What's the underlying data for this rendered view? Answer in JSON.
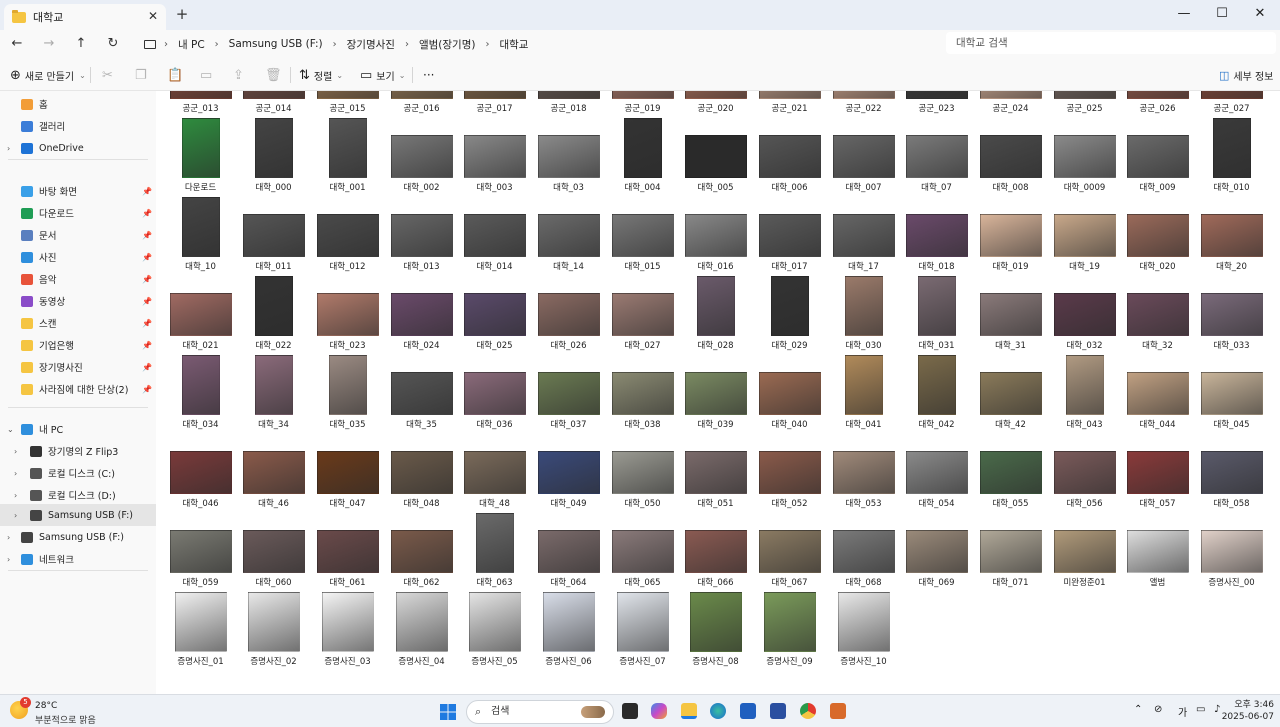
{
  "window": {
    "tab_title": "대학교",
    "tab_close": "✕",
    "new_tab": "+",
    "minimize": "—",
    "maximize": "☐",
    "close": "✕"
  },
  "nav": {
    "breadcrumbs": [
      "내 PC",
      "Samsung USB (F:)",
      "장기명사진",
      "앨범(장기명)",
      "대학교"
    ],
    "search_placeholder": "대학교 검색"
  },
  "toolbar": {
    "new_label": "새로 만들기",
    "sort_label": "정렬",
    "view_label": "보기",
    "more_label": "···",
    "details_label": "세부 정보"
  },
  "sidebar": {
    "items": [
      {
        "label": "홈",
        "icon": "home-icon",
        "color": "#f29d38"
      },
      {
        "label": "갤러리",
        "icon": "gallery-icon",
        "color": "#3b7dd8"
      },
      {
        "label": "OneDrive",
        "icon": "cloud-icon",
        "color": "#1e73d6"
      },
      {
        "label": "바탕 화면",
        "icon": "desktop-icon",
        "color": "#3aa0e8"
      },
      {
        "label": "다운로드",
        "icon": "download-icon",
        "color": "#1f9d55"
      },
      {
        "label": "문서",
        "icon": "document-icon",
        "color": "#5a7fbf"
      },
      {
        "label": "사진",
        "icon": "pictures-icon",
        "color": "#2f8fdd"
      },
      {
        "label": "음악",
        "icon": "music-icon",
        "color": "#e8533a"
      },
      {
        "label": "동영상",
        "icon": "video-icon",
        "color": "#8a4cc8"
      },
      {
        "label": "스캔",
        "icon": "folder-icon",
        "color": "#f5c542"
      },
      {
        "label": "기업은행",
        "icon": "folder-icon",
        "color": "#f5c542"
      },
      {
        "label": "장기명사진",
        "icon": "folder-icon",
        "color": "#f5c542"
      },
      {
        "label": "사라짐에 대한 단상(2)",
        "icon": "folder-icon",
        "color": "#f5c542"
      },
      {
        "label": "내 PC",
        "icon": "pc-icon",
        "color": "#2f8fdd"
      },
      {
        "label": "장기명의 Z Flip3",
        "icon": "phone-icon",
        "color": "#333333"
      },
      {
        "label": "로컬 디스크 (C:)",
        "icon": "disk-icon",
        "color": "#555555"
      },
      {
        "label": "로컬 디스크 (D:)",
        "icon": "disk-icon",
        "color": "#555555"
      },
      {
        "label": "Samsung USB (F:)",
        "icon": "usb-icon",
        "color": "#444444"
      },
      {
        "label": "Samsung USB (F:)",
        "icon": "usb-icon",
        "color": "#444444"
      },
      {
        "label": "네트워크",
        "icon": "network-icon",
        "color": "#2f8fdd"
      }
    ]
  },
  "files": [
    {
      "name": "공군_013",
      "tone": "#8c4a3a"
    },
    {
      "name": "공군_014",
      "tone": "#7a4f45"
    },
    {
      "name": "공군_015",
      "tone": "#a07a52"
    },
    {
      "name": "공군_016",
      "tone": "#9a7a55"
    },
    {
      "name": "공군_017",
      "tone": "#8a6a48"
    },
    {
      "name": "공군_018",
      "tone": "#6a5a52"
    },
    {
      "name": "공군_019",
      "tone": "#b07a6a"
    },
    {
      "name": "공군_020",
      "tone": "#b0705a"
    },
    {
      "name": "공군_021",
      "tone": "#c7a08a"
    },
    {
      "name": "공군_022",
      "tone": "#d4a890"
    },
    {
      "name": "공군_023",
      "tone": "#3a3a3a"
    },
    {
      "name": "공군_024",
      "tone": "#d8b098"
    },
    {
      "name": "공군_025",
      "tone": "#7a6a62"
    },
    {
      "name": "공군_026",
      "tone": "#9a5a4a"
    },
    {
      "name": "공군_027",
      "tone": "#8a4a3a"
    },
    {
      "name": "다운로드",
      "tone": "#2e8b3e"
    },
    {
      "name": "대학_000",
      "tone": "#444444"
    },
    {
      "name": "대학_001",
      "tone": "#555555"
    },
    {
      "name": "대학_002",
      "tone": "#777777"
    },
    {
      "name": "대학_003",
      "tone": "#888888"
    },
    {
      "name": "대학_03",
      "tone": "#8a8a8a"
    },
    {
      "name": "대학_004",
      "tone": "#333333"
    },
    {
      "name": "대학_005",
      "tone": "#2a2a2a"
    },
    {
      "name": "대학_006",
      "tone": "#555555"
    },
    {
      "name": "대학_007",
      "tone": "#666666"
    },
    {
      "name": "대학_07",
      "tone": "#7a7a7a"
    },
    {
      "name": "대학_008",
      "tone": "#4a4a4a"
    },
    {
      "name": "대학_0009",
      "tone": "#8a8a8a"
    },
    {
      "name": "대학_009",
      "tone": "#6a6a6a"
    },
    {
      "name": "대학_010",
      "tone": "#3a3a3a"
    },
    {
      "name": "대학_10",
      "tone": "#444444"
    },
    {
      "name": "대학_011",
      "tone": "#555555"
    },
    {
      "name": "대학_012",
      "tone": "#4a4a4a"
    },
    {
      "name": "대학_013",
      "tone": "#666666"
    },
    {
      "name": "대학_014",
      "tone": "#5a5a5a"
    },
    {
      "name": "대학_14",
      "tone": "#6a6a6a"
    },
    {
      "name": "대학_015",
      "tone": "#777777"
    },
    {
      "name": "대학_016",
      "tone": "#888888"
    },
    {
      "name": "대학_017",
      "tone": "#5a5a5a"
    },
    {
      "name": "대학_17",
      "tone": "#666666"
    },
    {
      "name": "대학_018",
      "tone": "#6a4a6a"
    },
    {
      "name": "대학_019",
      "tone": "#d8b49a"
    },
    {
      "name": "대학_19",
      "tone": "#c8a88a"
    },
    {
      "name": "대학_020",
      "tone": "#9a6a5a"
    },
    {
      "name": "대학_20",
      "tone": "#a06a5a"
    },
    {
      "name": "대학_021",
      "tone": "#a06a62"
    },
    {
      "name": "대학_022",
      "tone": "#333333"
    },
    {
      "name": "대학_023",
      "tone": "#b07a6a"
    },
    {
      "name": "대학_024",
      "tone": "#6a4a6a"
    },
    {
      "name": "대학_025",
      "tone": "#5a4a6a"
    },
    {
      "name": "대학_026",
      "tone": "#8a6a62"
    },
    {
      "name": "대학_027",
      "tone": "#9a7a72"
    },
    {
      "name": "대학_028",
      "tone": "#6a5a6a"
    },
    {
      "name": "대학_029",
      "tone": "#333333"
    },
    {
      "name": "대학_030",
      "tone": "#9a7a6a"
    },
    {
      "name": "대학_031",
      "tone": "#7a6a72"
    },
    {
      "name": "대학_31",
      "tone": "#8a7a7a"
    },
    {
      "name": "대학_032",
      "tone": "#5a3a4a"
    },
    {
      "name": "대학_32",
      "tone": "#6a4a5a"
    },
    {
      "name": "대학_033",
      "tone": "#7a6a7a"
    },
    {
      "name": "대학_034",
      "tone": "#7a5a72"
    },
    {
      "name": "대학_34",
      "tone": "#8a6a7a"
    },
    {
      "name": "대학_035",
      "tone": "#9a8a82"
    },
    {
      "name": "대학_35",
      "tone": "#555555"
    },
    {
      "name": "대학_036",
      "tone": "#8a6a7a"
    },
    {
      "name": "대학_037",
      "tone": "#6a7a52"
    },
    {
      "name": "대학_038",
      "tone": "#8a8a72"
    },
    {
      "name": "대학_039",
      "tone": "#7a8a62"
    },
    {
      "name": "대학_040",
      "tone": "#9a6a52"
    },
    {
      "name": "대학_041",
      "tone": "#b08a5a"
    },
    {
      "name": "대학_042",
      "tone": "#7a6a4a"
    },
    {
      "name": "대학_42",
      "tone": "#8a7a5a"
    },
    {
      "name": "대학_043",
      "tone": "#b09a82"
    },
    {
      "name": "대학_044",
      "tone": "#c0a082"
    },
    {
      "name": "대학_045",
      "tone": "#c8b49a"
    },
    {
      "name": "대학_046",
      "tone": "#7a3a3a"
    },
    {
      "name": "대학_46",
      "tone": "#8a5a4a"
    },
    {
      "name": "대학_047",
      "tone": "#6a3a1a"
    },
    {
      "name": "대학_048",
      "tone": "#6a5a4a"
    },
    {
      "name": "대학_48",
      "tone": "#7a6a5a"
    },
    {
      "name": "대학_049",
      "tone": "#3a4a7a"
    },
    {
      "name": "대학_050",
      "tone": "#9a9a92"
    },
    {
      "name": "대학_051",
      "tone": "#7a6a6a"
    },
    {
      "name": "대학_052",
      "tone": "#8a5a4a"
    },
    {
      "name": "대학_053",
      "tone": "#a08a7a"
    },
    {
      "name": "대학_054",
      "tone": "#8a8a8a"
    },
    {
      "name": "대학_055",
      "tone": "#4a6a4a"
    },
    {
      "name": "대학_056",
      "tone": "#7a5a5a"
    },
    {
      "name": "대학_057",
      "tone": "#8a3a3a"
    },
    {
      "name": "대학_058",
      "tone": "#5a5a6a"
    },
    {
      "name": "대학_059",
      "tone": "#7a7a72"
    },
    {
      "name": "대학_060",
      "tone": "#6a5a5a"
    },
    {
      "name": "대학_061",
      "tone": "#6a4a4a"
    },
    {
      "name": "대학_062",
      "tone": "#7a5a4a"
    },
    {
      "name": "대학_063",
      "tone": "#6a6a6a"
    },
    {
      "name": "대학_064",
      "tone": "#7a6a6a"
    },
    {
      "name": "대학_065",
      "tone": "#8a7a7a"
    },
    {
      "name": "대학_066",
      "tone": "#8a5a52"
    },
    {
      "name": "대학_067",
      "tone": "#8a7a62"
    },
    {
      "name": "대학_068",
      "tone": "#7a7a7a"
    },
    {
      "name": "대학_069",
      "tone": "#9a8a7a"
    },
    {
      "name": "대학_071",
      "tone": "#b0a898"
    },
    {
      "name": "미완정준01",
      "tone": "#b09a7a"
    },
    {
      "name": "앨범",
      "tone": "#dddddd"
    },
    {
      "name": "증명사진_00",
      "tone": "#e0d0c8"
    },
    {
      "name": "증명사진_01",
      "tone": "#f0f0f0"
    },
    {
      "name": "증명사진_02",
      "tone": "#e8e8e8"
    },
    {
      "name": "증명사진_03",
      "tone": "#f4f4f4"
    },
    {
      "name": "증명사진_04",
      "tone": "#d8d8d8"
    },
    {
      "name": "증명사진_05",
      "tone": "#e4e4e4"
    },
    {
      "name": "증명사진_06",
      "tone": "#d8dde8"
    },
    {
      "name": "증명사진_07",
      "tone": "#e0e4ea"
    },
    {
      "name": "증명사진_08",
      "tone": "#6a8a4a"
    },
    {
      "name": "증명사진_09",
      "tone": "#7a9a5a"
    },
    {
      "name": "증명사진_10",
      "tone": "#e8e8e8"
    }
  ],
  "taskbar": {
    "notification_count": "5",
    "temperature": "28°C",
    "weather_text": "부분적으로 맑음",
    "search_label": "검색",
    "time": "오후 3:46",
    "date": "2025-06-07",
    "ime": "가"
  }
}
